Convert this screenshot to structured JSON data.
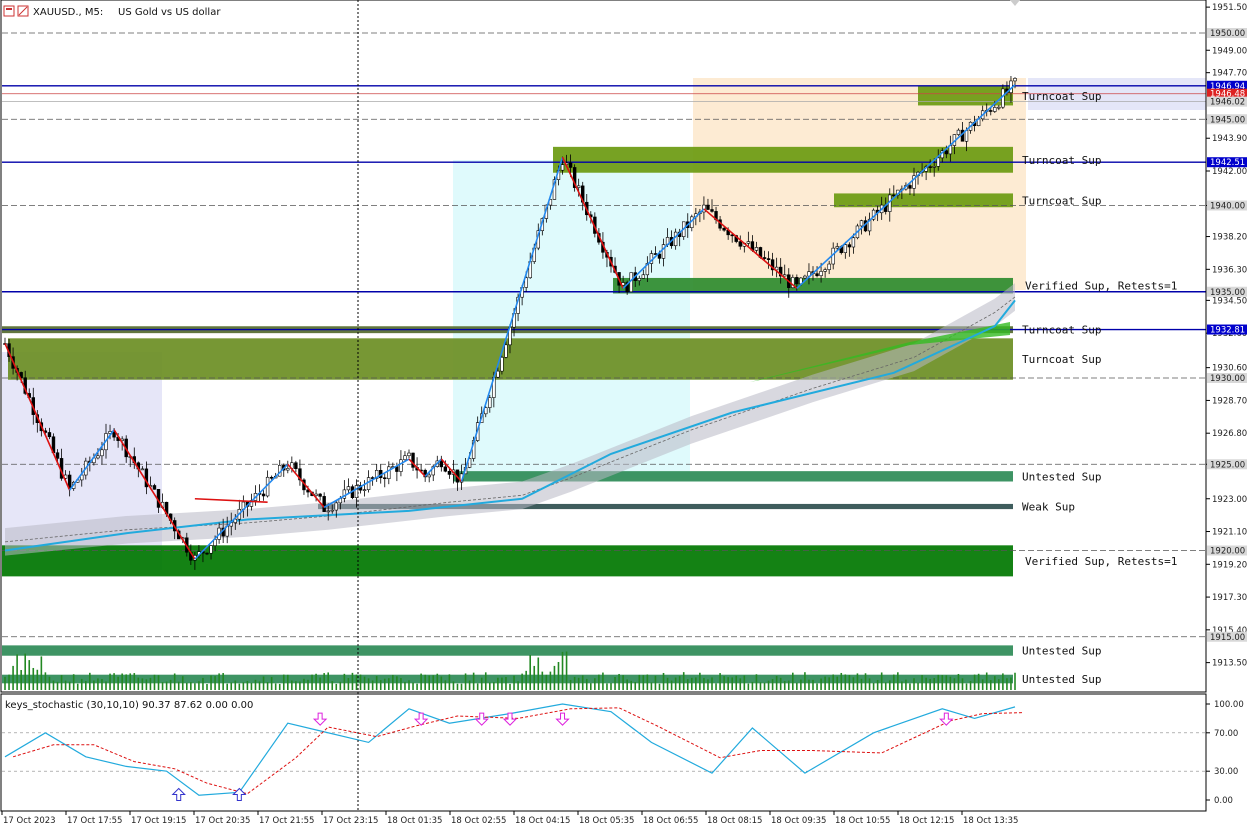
{
  "header": {
    "symbol": "XAUUSD., M5:",
    "description": "US Gold vs US dollar"
  },
  "indicator": {
    "title": "keys_stochastic (30,10,10) 90.37 87.62 0.00 0.00",
    "levels": [
      "100.00",
      "70.00",
      "30.00",
      "0.00"
    ]
  },
  "chart_data": {
    "type": "candlestick",
    "symbol": "XAUUSD.",
    "timeframe": "M5",
    "y_axis_ticks": [
      "1951.50",
      "1949.00",
      "1947.70",
      "1945.00",
      "1943.90",
      "1942.00",
      "1940.00",
      "1938.20",
      "1936.30",
      "1934.50",
      "1932.60",
      "1930.60",
      "1928.70",
      "1926.80",
      "1925.00",
      "1923.00",
      "1921.10",
      "1919.20",
      "1917.30",
      "1915.40",
      "1913.50"
    ],
    "price_labels": [
      {
        "text": "1950.00",
        "style": "grey"
      },
      {
        "text": "1946.94",
        "style": "blue"
      },
      {
        "text": "1946.48",
        "style": "red"
      },
      {
        "text": "1946.02",
        "style": "grey"
      },
      {
        "text": "1945.00",
        "style": "grey"
      },
      {
        "text": "1942.51",
        "style": "blue"
      },
      {
        "text": "1940.00",
        "style": "grey"
      },
      {
        "text": "1935.00",
        "style": "grey"
      },
      {
        "text": "1932.81",
        "style": "blue"
      },
      {
        "text": "1930.00",
        "style": "grey"
      },
      {
        "text": "1925.00",
        "style": "grey"
      },
      {
        "text": "1920.00",
        "style": "grey"
      },
      {
        "text": "1915.00",
        "style": "grey"
      }
    ],
    "x_axis_labels": [
      "17 Oct 2023",
      "17 Oct 17:55",
      "17 Oct 19:15",
      "17 Oct 20:35",
      "17 Oct 21:55",
      "17 Oct 23:15",
      "18 Oct 01:35",
      "18 Oct 02:55",
      "18 Oct 04:15",
      "18 Oct 05:35",
      "18 Oct 06:55",
      "18 Oct 08:15",
      "18 Oct 09:35",
      "18 Oct 10:55",
      "18 Oct 12:15",
      "18 Oct 13:35"
    ],
    "zones": [
      {
        "label": "Turncoat Sup",
        "low": 1945.8,
        "high": 1946.9,
        "color": "#6b9a10"
      },
      {
        "label": "Turncoat Sup",
        "low": 1941.9,
        "high": 1943.4,
        "color": "#6b9a10"
      },
      {
        "label": "Turncoat Sup",
        "low": 1939.9,
        "high": 1940.7,
        "color": "#6b9a10"
      },
      {
        "label": "Verified Sup, Retests=1",
        "low": 1934.9,
        "high": 1935.8,
        "color": "#2e8b2e"
      },
      {
        "label": "Turncoat Sup",
        "low": 1932.6,
        "high": 1933.0,
        "color": "#556b2f"
      },
      {
        "label": "Turncoat Sup",
        "low": 1929.9,
        "high": 1932.3,
        "color": "#6b8e23"
      },
      {
        "label": "Untested Sup",
        "low": 1924.0,
        "high": 1924.6,
        "color": "#2e8b57"
      },
      {
        "label": "Weak Sup",
        "low": 1922.4,
        "high": 1922.7,
        "color": "#2f4f4f"
      },
      {
        "label": "Untested Sup",
        "low": 1913.9,
        "high": 1914.5,
        "color": "#2e8b57"
      },
      {
        "label": "Untested Sup",
        "low": 1912.3,
        "high": 1912.8,
        "color": "#2e8b57"
      },
      {
        "label": "Verified Sup, Retests=1",
        "low": 1918.5,
        "high": 1920.3,
        "color": "#007700"
      }
    ],
    "zigzag_points": [
      {
        "bar": 0,
        "price": 1932.0
      },
      {
        "bar": 16,
        "price": 1923.5
      },
      {
        "bar": 27,
        "price": 1927.0
      },
      {
        "bar": 47,
        "price": 1919.5
      },
      {
        "bar": 70,
        "price": 1925.0
      },
      {
        "bar": 79,
        "price": 1922.5
      },
      {
        "bar": 100,
        "price": 1925.3
      },
      {
        "bar": 104,
        "price": 1924.3
      },
      {
        "bar": 108,
        "price": 1925.3
      },
      {
        "bar": 113,
        "price": 1924.0
      },
      {
        "bar": 138,
        "price": 1942.8
      },
      {
        "bar": 153,
        "price": 1935.2
      },
      {
        "bar": 173,
        "price": 1939.8
      },
      {
        "bar": 196,
        "price": 1935.2
      },
      {
        "bar": 250,
        "price": 1947.0
      }
    ],
    "stochastic": {
      "main": 90.37,
      "signal": 87.62,
      "buy_arrow_bars": [
        43,
        58
      ],
      "sell_arrow_bars": [
        78,
        103,
        118,
        125,
        138,
        233
      ]
    }
  }
}
